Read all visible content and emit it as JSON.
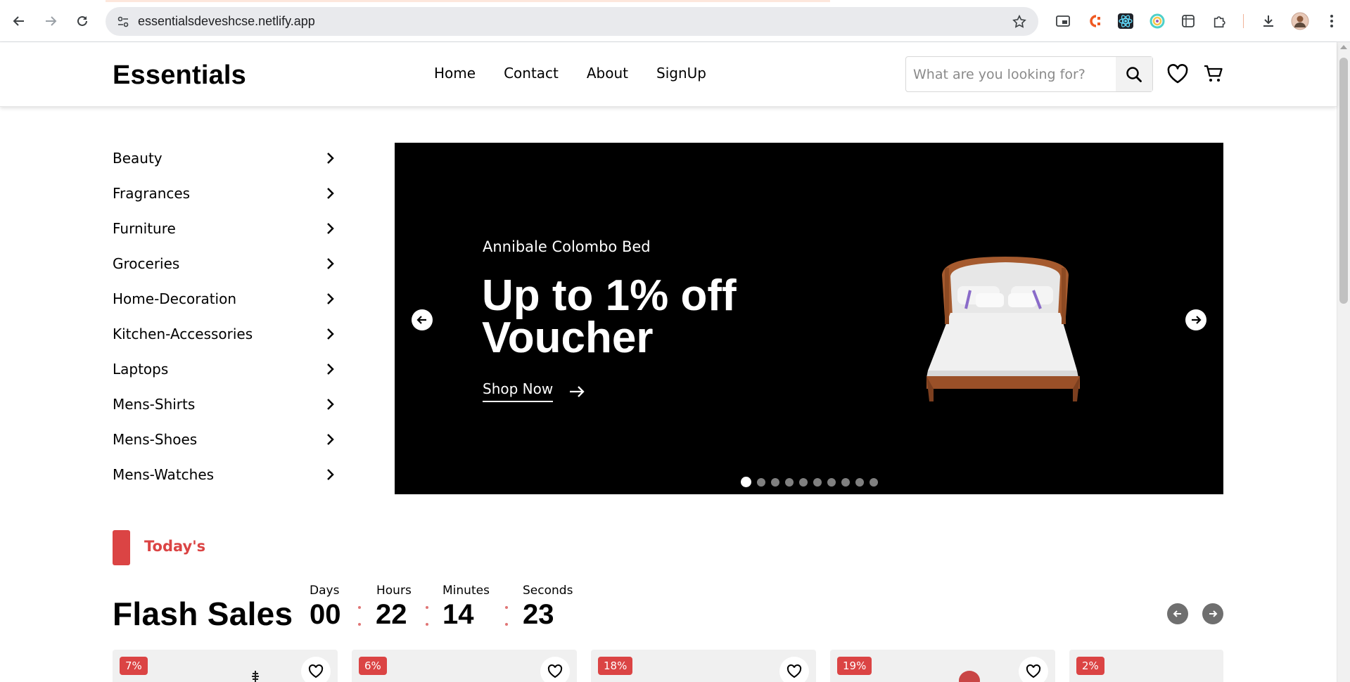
{
  "browser": {
    "url": "essentialsdeveshcse.netlify.app",
    "back_icon": "back-arrow-icon",
    "forward_icon": "forward-arrow-icon",
    "reload_icon": "reload-icon"
  },
  "header": {
    "logo": "Essentials",
    "nav": [
      "Home",
      "Contact",
      "About",
      "SignUp"
    ],
    "search_placeholder": "What are you looking for?"
  },
  "categories": [
    "Beauty",
    "Fragrances",
    "Furniture",
    "Groceries",
    "Home-Decoration",
    "Kitchen-Accessories",
    "Laptops",
    "Mens-Shirts",
    "Mens-Shoes",
    "Mens-Watches"
  ],
  "hero": {
    "product_name": "Annibale Colombo Bed",
    "headline": "Up to 1% off Voucher",
    "cta": "Shop Now",
    "slide_count": 10,
    "active_slide": 1
  },
  "todays": {
    "label": "Today's"
  },
  "flash_sales": {
    "title": "Flash Sales",
    "countdown": {
      "days_label": "Days",
      "days": "00",
      "hours_label": "Hours",
      "hours": "22",
      "minutes_label": "Minutes",
      "minutes": "14",
      "seconds_label": "Seconds",
      "seconds": "23"
    },
    "products": [
      {
        "discount": "7%"
      },
      {
        "discount": "6%"
      },
      {
        "discount": "18%"
      },
      {
        "discount": "19%"
      },
      {
        "discount": "2%"
      }
    ]
  },
  "colors": {
    "accent": "#db4444",
    "hero_bg": "#000000"
  }
}
